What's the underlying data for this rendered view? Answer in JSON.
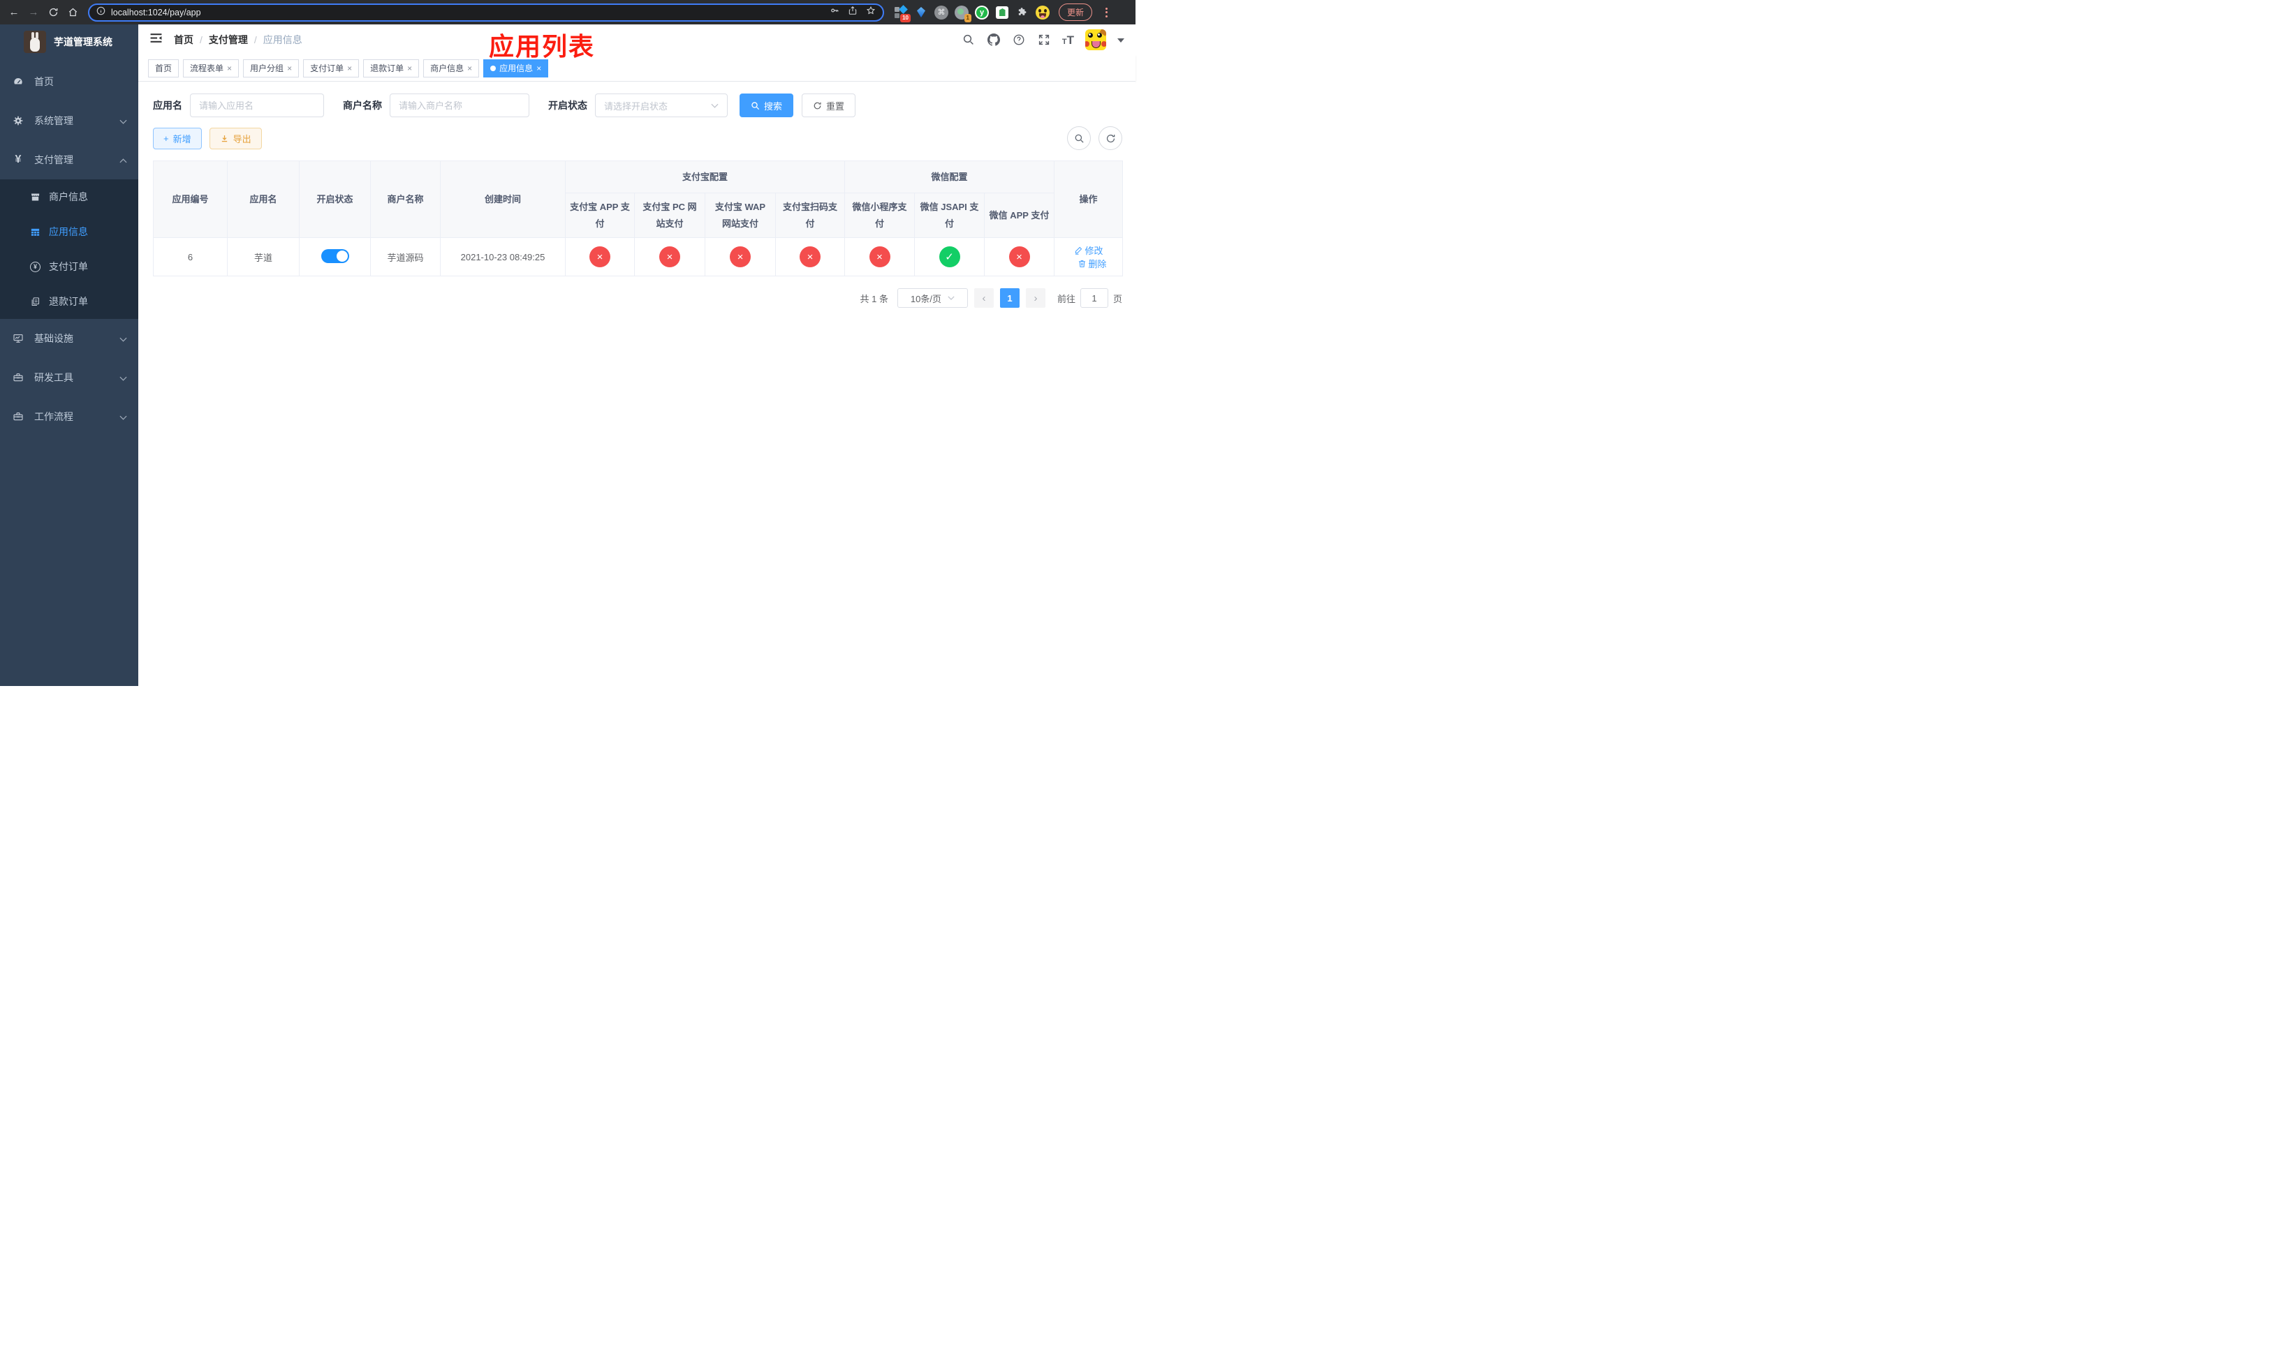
{
  "browser": {
    "url": "localhost:1024/pay/app",
    "update_label": "更新",
    "badges": {
      "diamond": "10",
      "target": "1"
    },
    "ext_y_letter": "y",
    "ext_command": "⌘"
  },
  "sidebar": {
    "title": "芋道管理系统",
    "menu": [
      {
        "label": "首页"
      },
      {
        "label": "系统管理"
      },
      {
        "label": "支付管理"
      },
      {
        "label": "基础设施"
      },
      {
        "label": "研发工具"
      },
      {
        "label": "工作流程"
      }
    ],
    "submenu": [
      {
        "label": "商户信息"
      },
      {
        "label": "应用信息"
      },
      {
        "label": "支付订单"
      },
      {
        "label": "退款订单"
      }
    ]
  },
  "header": {
    "breadcrumb": [
      "首页",
      "支付管理",
      "应用信息"
    ],
    "annotation": "应用列表"
  },
  "tabs": [
    {
      "label": "首页"
    },
    {
      "label": "流程表单"
    },
    {
      "label": "用户分组"
    },
    {
      "label": "支付订单"
    },
    {
      "label": "退款订单"
    },
    {
      "label": "商户信息"
    },
    {
      "label": "应用信息"
    }
  ],
  "filters": {
    "app_name_label": "应用名",
    "app_name_placeholder": "请输入应用名",
    "merchant_label": "商户名称",
    "merchant_placeholder": "请输入商户名称",
    "status_label": "开启状态",
    "status_placeholder": "请选择开启状态",
    "search_label": "搜索",
    "reset_label": "重置"
  },
  "toolbar": {
    "add_label": "新增",
    "export_label": "导出"
  },
  "table": {
    "headers": {
      "app_id": "应用编号",
      "app_name": "应用名",
      "status": "开启状态",
      "merchant": "商户名称",
      "create_time": "创建时间",
      "alipay_group": "支付宝配置",
      "wechat_group": "微信配置",
      "actions": "操作",
      "alipay_cols": [
        "支付宝 APP 支付",
        "支付宝 PC 网站支付",
        "支付宝 WAP 网站支付",
        "支付宝扫码支付"
      ],
      "wechat_cols": [
        "微信小程序支付",
        "微信 JSAPI 支付",
        "微信 APP 支付"
      ]
    },
    "rows": [
      {
        "app_id": "6",
        "app_name": "芋道",
        "enabled": true,
        "merchant": "芋道源码",
        "create_time": "2021-10-23 08:49:25",
        "statuses": [
          "no",
          "no",
          "no",
          "no",
          "no",
          "yes",
          "no"
        ],
        "edit_label": "修改",
        "delete_label": "删除"
      }
    ]
  },
  "pagination": {
    "total": "共 1 条",
    "page_size": "10条/页",
    "current_page": "1",
    "goto_label": "前往",
    "goto_value": "1",
    "page_suffix": "页"
  }
}
